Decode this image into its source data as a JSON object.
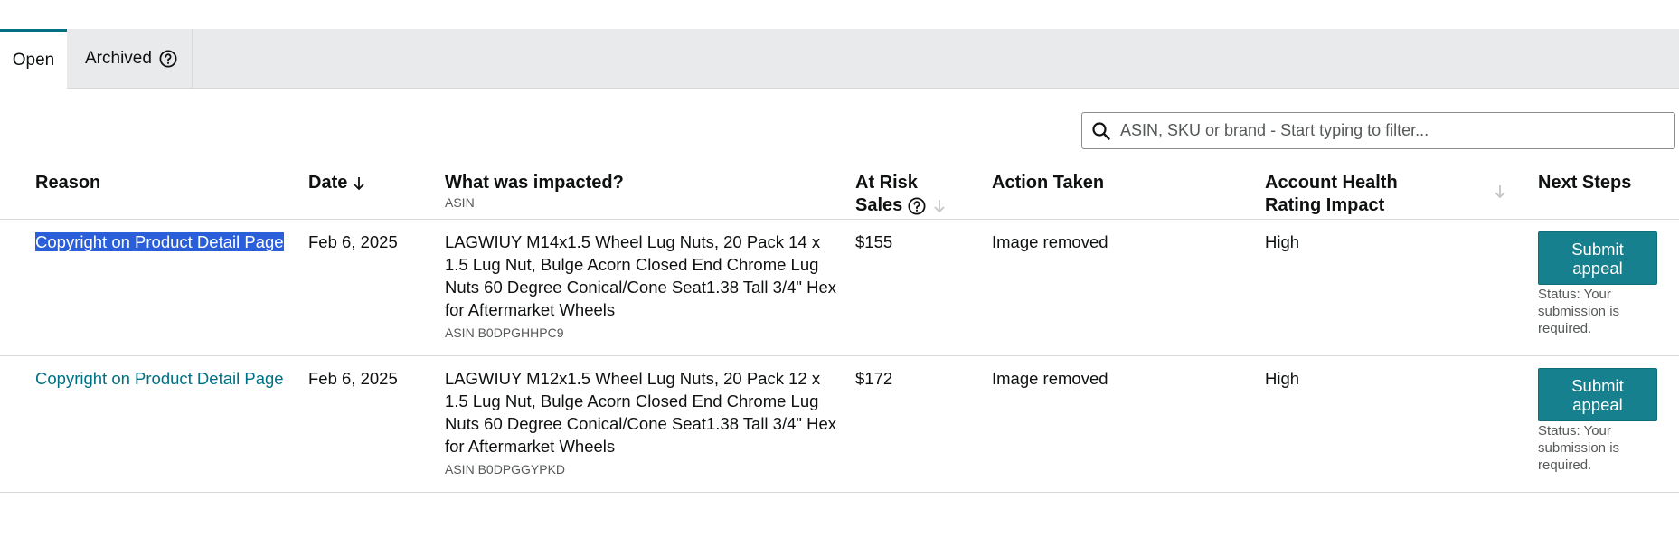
{
  "tabs": {
    "open_label": "Open",
    "archived_label": "Archived"
  },
  "search": {
    "placeholder": "ASIN, SKU or brand - Start typing to filter..."
  },
  "columns": {
    "reason": "Reason",
    "date": "Date",
    "impacted": "What was impacted?",
    "impacted_sub": "ASIN",
    "at_risk_line1": "At Risk",
    "at_risk_line2": "Sales",
    "action_taken": "Action Taken",
    "health_line1": "Account Health",
    "health_line2": "Rating Impact",
    "next_steps": "Next Steps"
  },
  "rows": [
    {
      "reason": "Copyright on Product Detail Page",
      "date": "Feb 6, 2025",
      "product": "LAGWIUY M14x1.5 Wheel Lug Nuts, 20 Pack 14 x 1.5 Lug Nut, Bulge Acorn Closed End Chrome Lug Nuts 60 Degree Conical/Cone Seat1.38 Tall 3/4\" Hex for Aftermarket Wheels",
      "asin": "ASIN B0DPGHHPC9",
      "at_risk": "$155",
      "action": "Image removed",
      "impact": "High",
      "button": "Submit appeal",
      "status": "Status: Your submission is required."
    },
    {
      "reason": "Copyright on Product Detail Page",
      "date": "Feb 6, 2025",
      "product": "LAGWIUY M12x1.5 Wheel Lug Nuts, 20 Pack 12 x 1.5 Lug Nut, Bulge Acorn Closed End Chrome Lug Nuts 60 Degree Conical/Cone Seat1.38 Tall 3/4\" Hex for Aftermarket Wheels",
      "asin": "ASIN B0DPGGYPKD",
      "at_risk": "$172",
      "action": "Image removed",
      "impact": "High",
      "button": "Submit appeal",
      "status": "Status: Your submission is required."
    }
  ],
  "colors": {
    "accent": "#007185",
    "button": "#16808e",
    "selection": "#2b5fd9"
  }
}
